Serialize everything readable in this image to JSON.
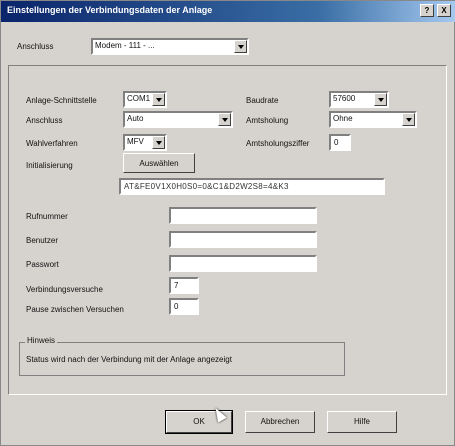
{
  "window": {
    "title": "Einstellungen der Verbindungsdaten der Anlage",
    "help_label": "?",
    "close_label": "X"
  },
  "top": {
    "label": "Anschluss",
    "value": "Modem - 111 - ..."
  },
  "left": {
    "schnittstelle_label": "Anlage-Schnittstelle",
    "schnittstelle_value": "COM1",
    "anschluss_label": "Anschluss",
    "anschluss_value": "Auto",
    "wahlverfahren_label": "Wahlverfahren",
    "wahlverfahren_value": "MFV",
    "init_label": "Initialisierung",
    "auswahlen_label": "Auswählen",
    "init_string": "AT&FE0V1X0H0S0=0&C1&D2W2S8=4&K3"
  },
  "right": {
    "baudrate_label": "Baudrate",
    "baudrate_value": "57600",
    "amtsholung_label": "Amtsholung",
    "amtsholung_value": "Ohne",
    "amtsholungszahl_label": "Amtsholungsziffer",
    "amtsholungszahl_value": "0"
  },
  "fields": {
    "rufnummer_label": "Rufnummer",
    "benutzer_label": "Benutzer",
    "passwort_label": "Passwort",
    "versuche_label": "Verbindungsversuche",
    "versuche_value": "7",
    "pause_label": "Pause zwischen Versuchen",
    "pause_value": "0"
  },
  "status": {
    "title": "Hinweis",
    "text": "Status wird nach der Verbindung mit der Anlage angezeigt"
  },
  "buttons": {
    "ok": "OK",
    "abbrechen": "Abbrechen",
    "hilfe": "Hilfe"
  }
}
